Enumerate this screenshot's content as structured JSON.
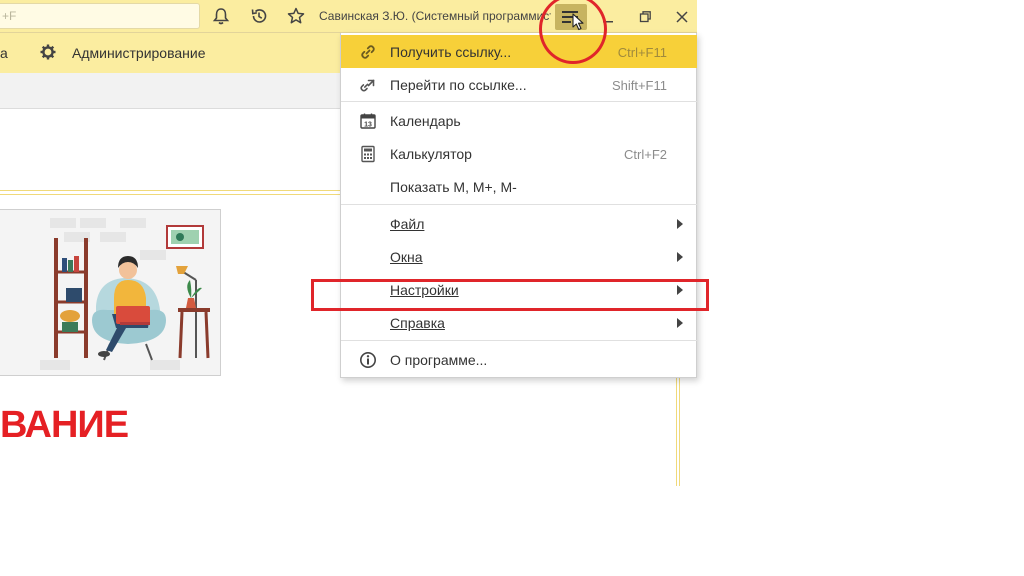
{
  "titlebar": {
    "search_text": "+F",
    "user_label": "Савинская З.Ю. (Системный программист)"
  },
  "sections": {
    "prev_item_label": "а",
    "admin_label": "Администрирование"
  },
  "content": {
    "headline": "ВАНИЕ"
  },
  "menu": {
    "items": [
      {
        "label": "Получить ссылку...",
        "shortcut": "Ctrl+F11",
        "icon": "link-icon"
      },
      {
        "label": "Перейти по ссылке...",
        "shortcut": "Shift+F11",
        "icon": "go-to-link-icon"
      },
      {
        "label": "Календарь",
        "shortcut": "",
        "icon": "calendar-icon",
        "calendar_day": "13"
      },
      {
        "label": "Калькулятор",
        "shortcut": "Ctrl+F2",
        "icon": "calculator-icon"
      },
      {
        "label": "Показать М, М+, М-",
        "shortcut": ""
      },
      {
        "label": "Файл",
        "submenu": true
      },
      {
        "label": "Окна",
        "submenu": true
      },
      {
        "label": "Настройки",
        "submenu": true
      },
      {
        "label": "Справка",
        "submenu": true
      },
      {
        "label": "О программе...",
        "icon": "info-icon"
      }
    ]
  },
  "colors": {
    "titlebar_bg": "#fbeda0",
    "menu_highlight": "#f7d039",
    "menu_button_active": "#c7b460",
    "annotation_red": "#e0252a",
    "headline_red": "#e52024"
  }
}
